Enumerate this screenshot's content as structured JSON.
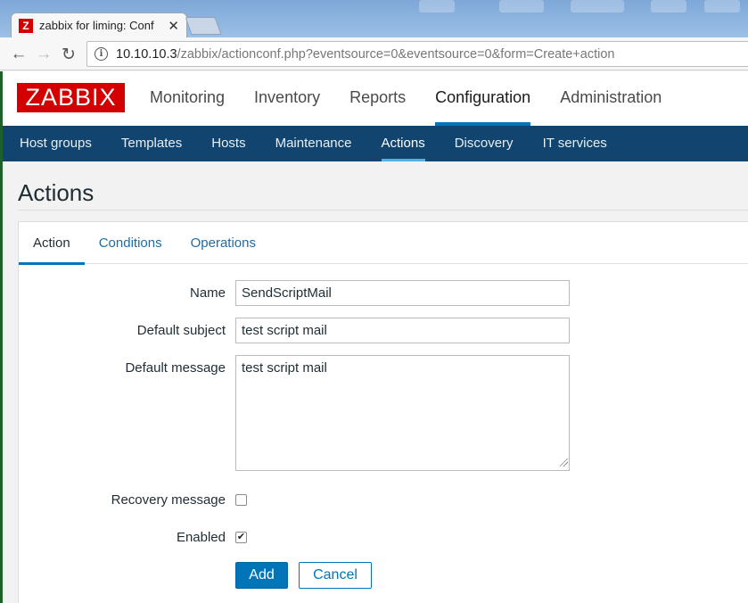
{
  "browser": {
    "tab_title": "zabbix for liming: Conf",
    "favicon_letter": "Z",
    "url_host": "10.10.10.3",
    "url_path": "/zabbix/actionconf.php?eventsource=0&eventsource=0&form=Create+action"
  },
  "header": {
    "logo": "ZABBIX",
    "menu": [
      "Monitoring",
      "Inventory",
      "Reports",
      "Configuration",
      "Administration"
    ],
    "active_menu": "Configuration"
  },
  "sub_nav": {
    "items": [
      "Host groups",
      "Templates",
      "Hosts",
      "Maintenance",
      "Actions",
      "Discovery",
      "IT services"
    ],
    "active": "Actions"
  },
  "page": {
    "title": "Actions",
    "tabs": [
      "Action",
      "Conditions",
      "Operations"
    ],
    "active_tab": "Action"
  },
  "form": {
    "name_label": "Name",
    "name_value": "SendScriptMail",
    "subject_label": "Default subject",
    "subject_value": "test script mail",
    "message_label": "Default message",
    "message_value": "test script mail",
    "recovery_label": "Recovery message",
    "recovery_checked": false,
    "enabled_label": "Enabled",
    "enabled_checked": true,
    "add_button": "Add",
    "cancel_button": "Cancel"
  },
  "colors": {
    "brand_red": "#d40000",
    "nav_blue": "#11456f",
    "accent_blue": "#0275b8"
  }
}
